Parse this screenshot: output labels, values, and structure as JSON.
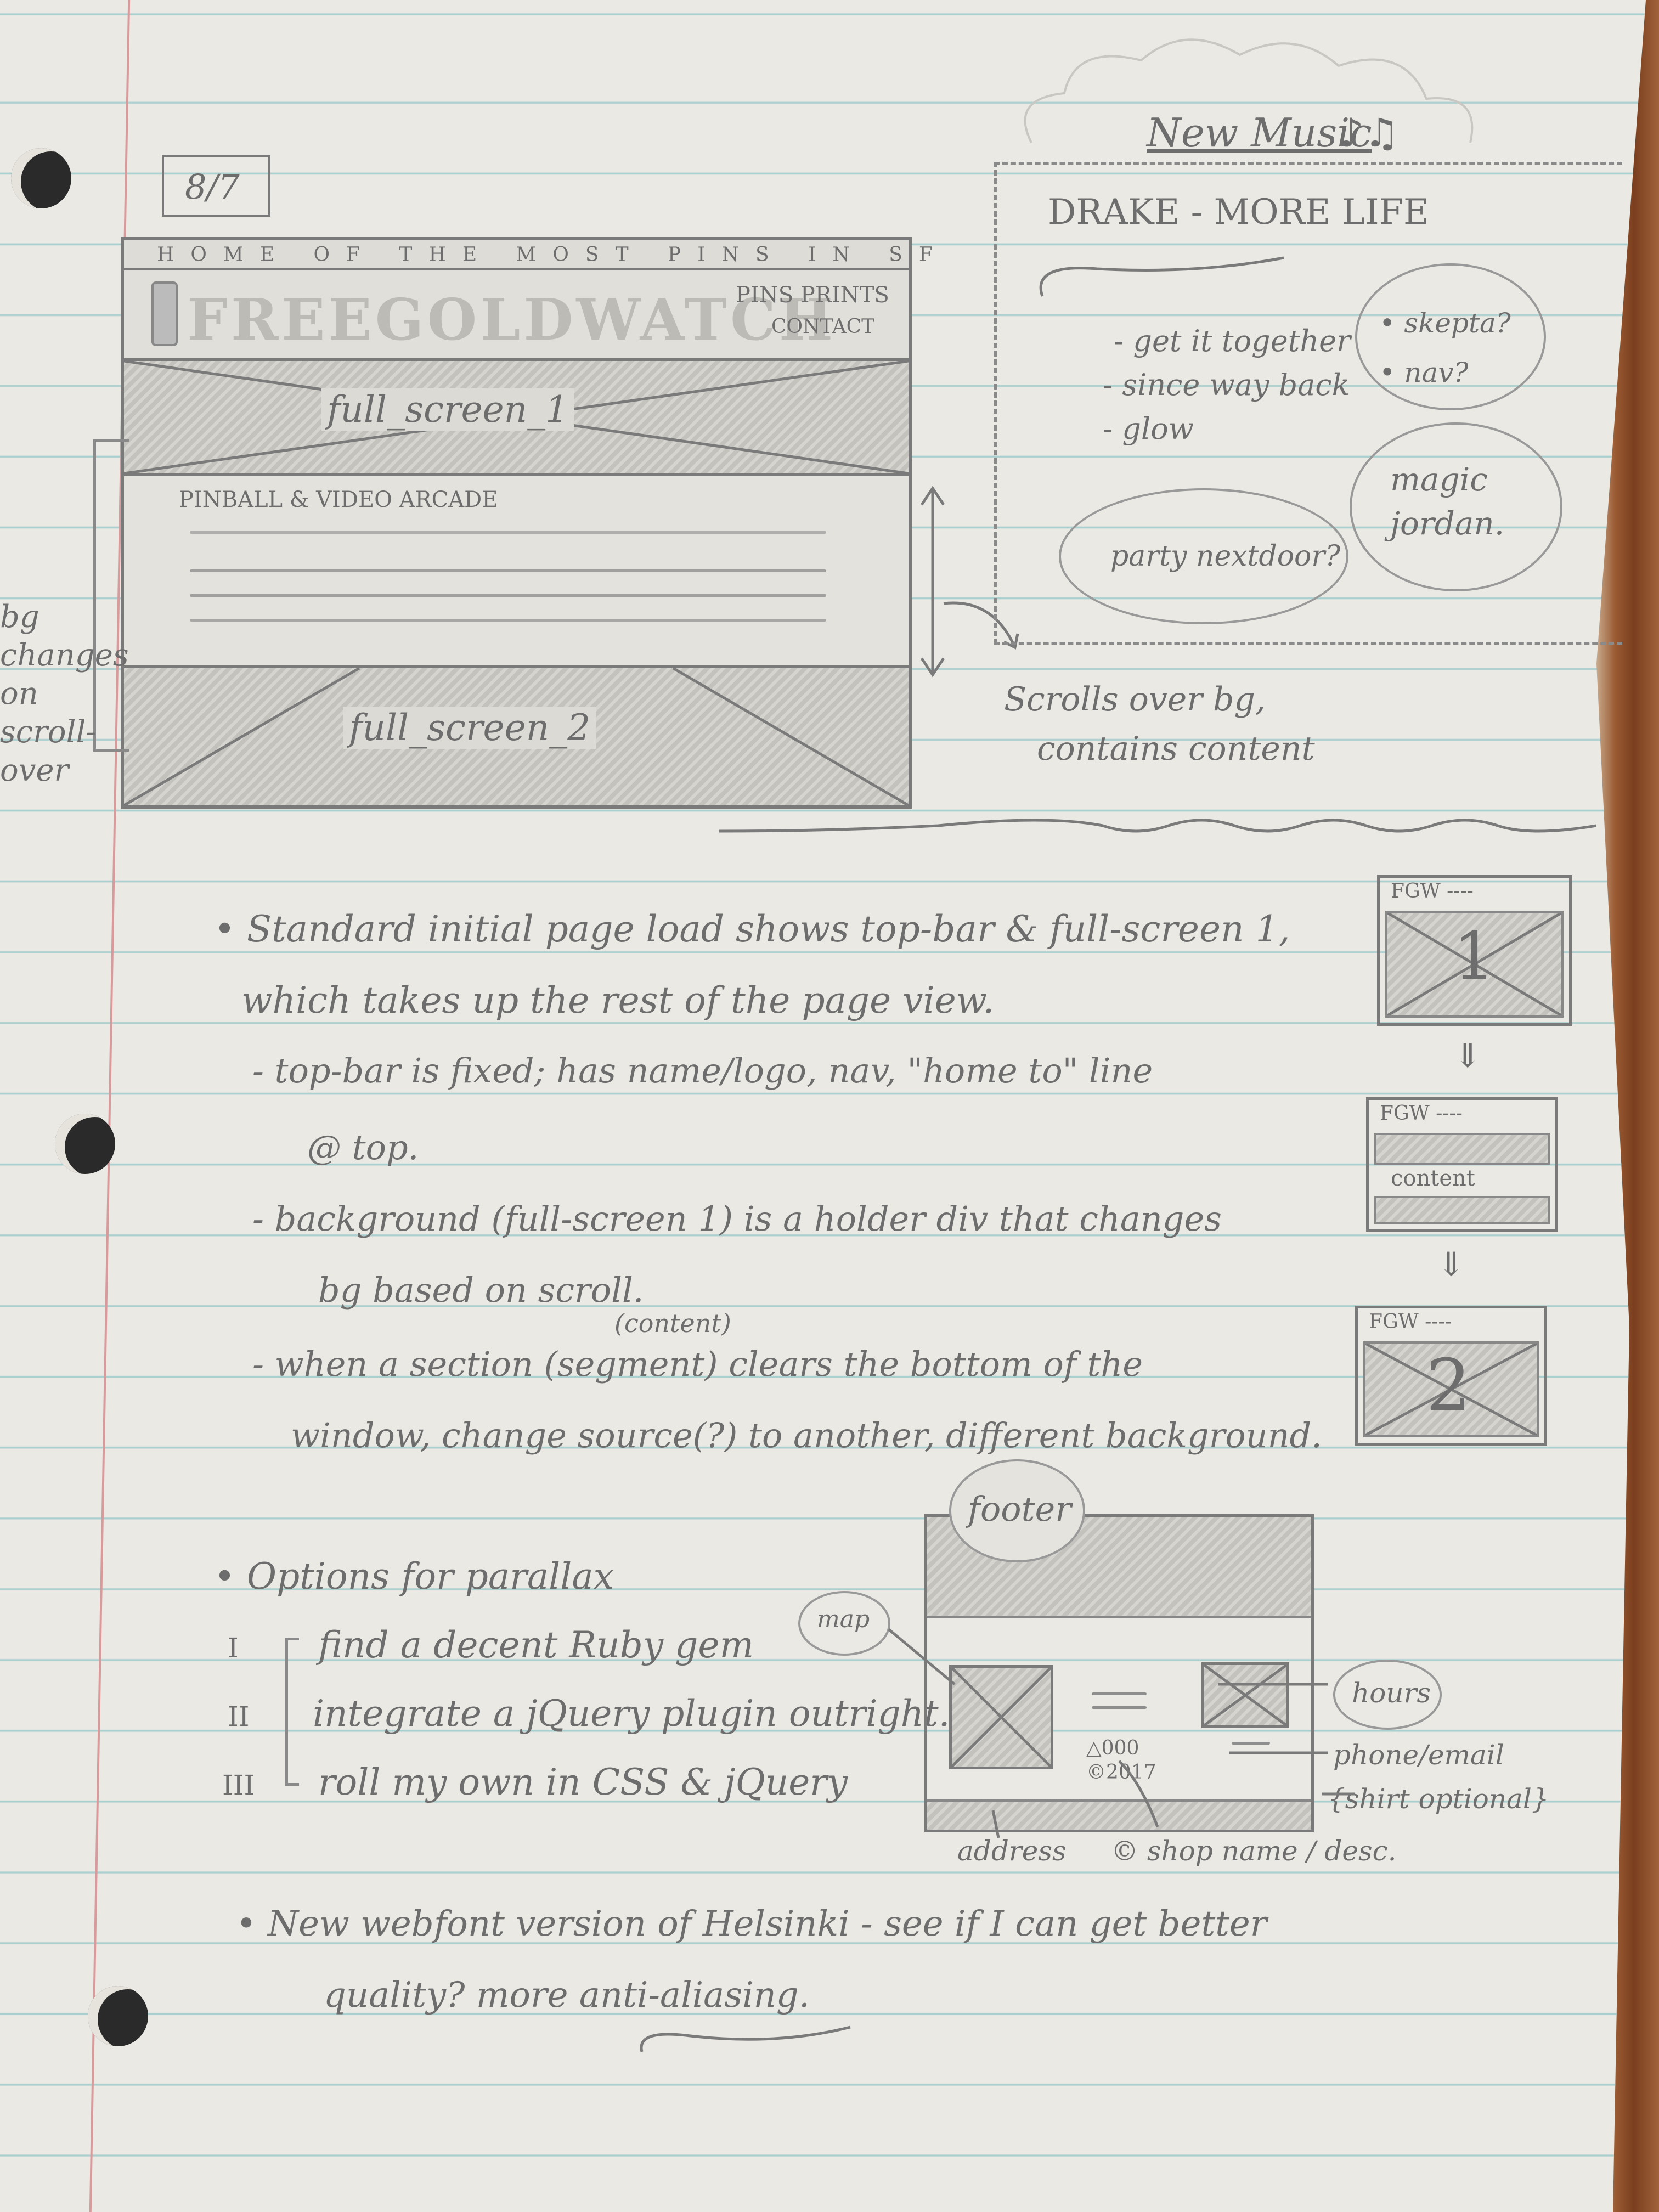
{
  "page_number": "8/7",
  "wireframe": {
    "topbar_text": "HOME OF THE MOST PINS IN SF",
    "logo_text": "FREEGOLDWATCH",
    "nav_line1": "PINS PRINTS",
    "nav_line2": "CONTACT",
    "fullscreen1_label": "full_screen_1",
    "content_heading": "PINBALL & VIDEO ARCADE",
    "fullscreen2_label": "full_screen_2",
    "left_note_lines": [
      "bg",
      "changes",
      "on",
      "scroll-",
      "over"
    ],
    "scroll_note_line1": "Scrolls over bg,",
    "scroll_note_line2": "contains content"
  },
  "music_note": {
    "title": "New Music",
    "track": "DRAKE - MORE LIFE",
    "items": [
      "- get it together",
      "- since way back",
      "- glow"
    ],
    "bubble1": "• skepta?  • nav?",
    "bubble2": "magic jordan.",
    "bubble3": "party nextdoor?"
  },
  "notes": {
    "b1_line1": "• Standard initial page load shows top-bar & full-screen 1,",
    "b1_line2": "which takes up the rest of the page view.",
    "b1_sub1_line1": "- top-bar is fixed; has name/logo, nav, \"home to\" line",
    "b1_sub1_line2": "@ top.",
    "b1_sub2_line1": "- background (full-screen 1) is a holder div that changes",
    "b1_sub2_line2": "bg based on scroll.",
    "b1_sub3_annot": "(content)",
    "b1_sub3_line1": "- when a section (segment) clears the bottom of the",
    "b1_sub3_line2": "window, change source(?) to another, different background.",
    "b2_title": "• Options for parallax",
    "options": [
      {
        "num": "I",
        "text": "find a decent Ruby gem"
      },
      {
        "num": "II",
        "text": "integrate a jQuery plugin outright."
      },
      {
        "num": "III",
        "text": "roll my own in CSS & jQuery"
      }
    ],
    "b3_line1": "• New webfont version of Helsinki - see if I can get better",
    "b3_line2": "quality? more anti-aliasing."
  },
  "thumbs": [
    {
      "header": "FGW ----",
      "label": "1"
    },
    {
      "header": "FGW ----",
      "label": "content"
    },
    {
      "header": "FGW ----",
      "label": "2"
    }
  ],
  "footer_sketch": {
    "title": "footer",
    "map": "map",
    "hours": "hours",
    "phone_email": "phone/email",
    "shirt": "{shirt optional}",
    "address": "address",
    "copyright": "© shop name / desc.",
    "small_text": "△000 ©2017"
  }
}
